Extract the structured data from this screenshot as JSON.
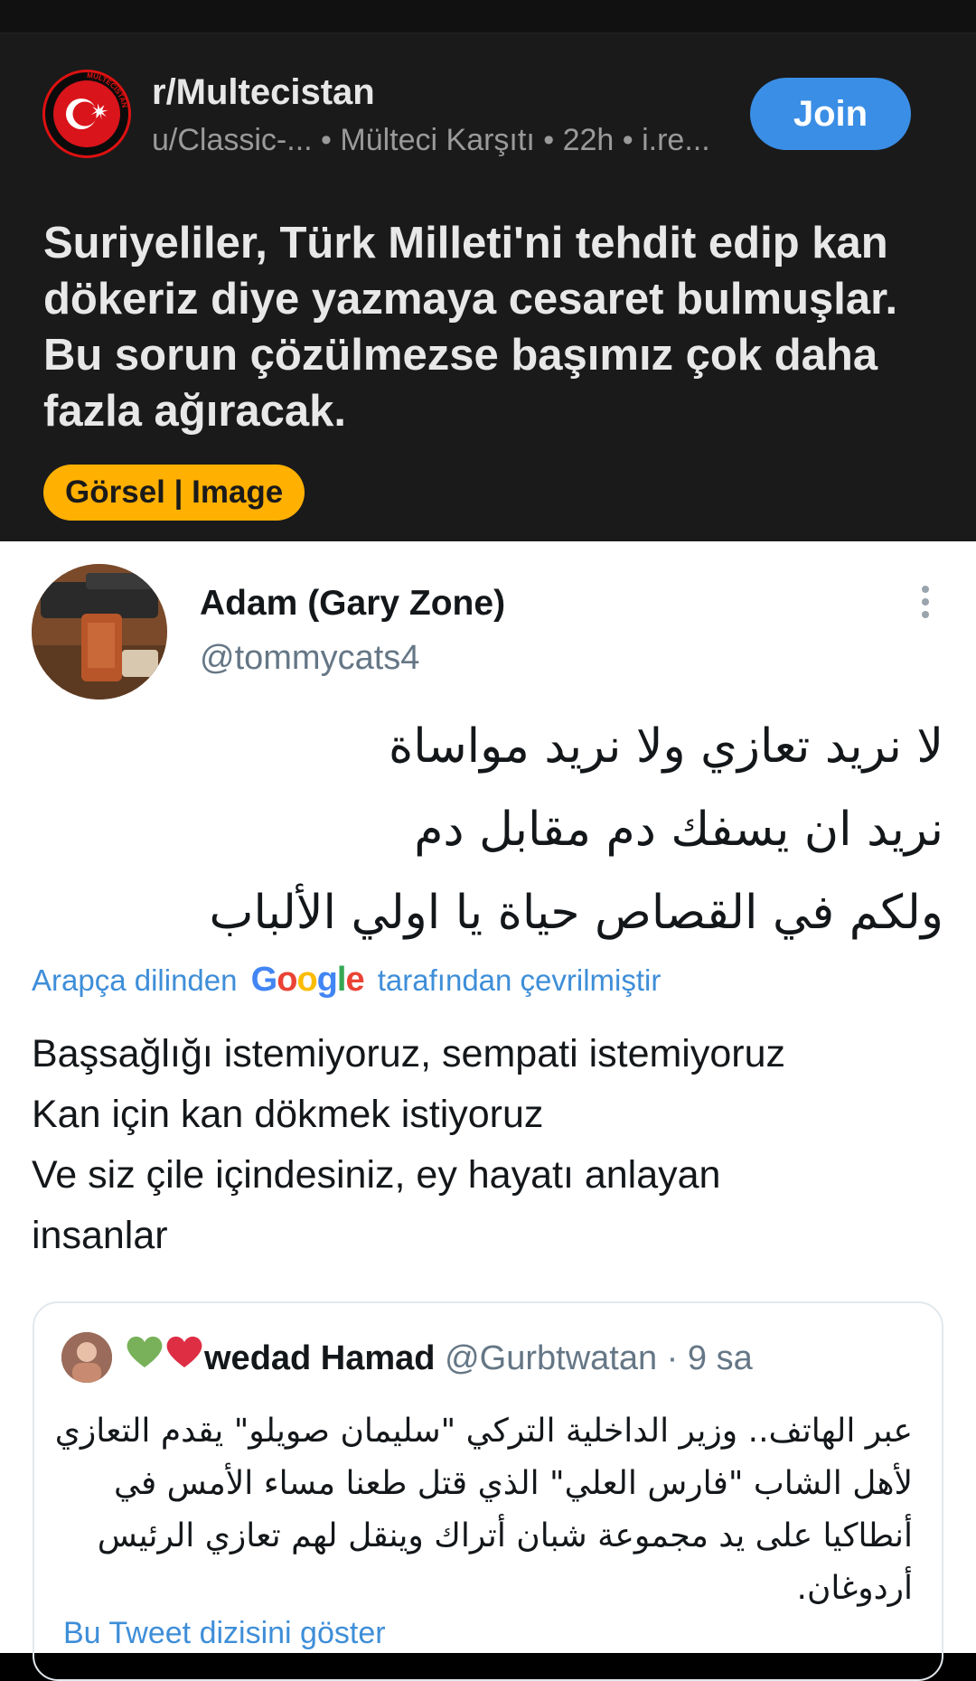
{
  "reddit": {
    "subreddit": "r/Multecistan",
    "meta": "u/Classic-... • Mülteci Karşıtı • 22h • i.re...",
    "join_label": "Join",
    "post_title": "Suriyeliler, Türk Milleti'ni tehdit edip kan dökeriz diye yazmaya cesaret bulmuşlar. Bu sorun çözülmezse başımız çok daha fazla ağıracak.",
    "flair": "Görsel | Image",
    "logo_text": "MULTECISTAN"
  },
  "tweet": {
    "display_name": "Adam (Gary Zone)",
    "handle": "@tommycats4",
    "arabic_lines": [
      "لا نريد تعازي ولا نريد مواساة",
      "نريد ان يسفك دم مقابل دم",
      "ولكم في القصاص حياة يا اولي الألباب"
    ],
    "translate_prefix": "Arapça dilinden",
    "translate_brand": "Google",
    "translate_suffix": "tarafından çevrilmiştir",
    "translation_lines": [
      "Başsağlığı istemiyoruz, sempati istemiyoruz",
      "Kan için kan dökmek istiyoruz",
      "Ve siz çile içindesiniz, ey hayatı anlayan",
      "insanlar"
    ]
  },
  "quote": {
    "name": "wedad Hamad",
    "handle": "@Gurbtwatan",
    "time": "· 9 sa",
    "emojis": "💚❤️",
    "text": "عبر الهاتف.. وزير الداخلية التركي \"سليمان صويلو\" يقدم التعازي لأهل الشاب \"فارس العلي\" الذي قتل طعنا مساء الأمس في أنطاكيا على يد مجموعة شبان أتراك وينقل لهم تعازي الرئيس أردوغان.",
    "show_thread": "Bu Tweet dizisini göster"
  },
  "colors": {
    "reddit_bg": "#1a1a1b",
    "join_blue": "#3a8ee6",
    "flair_yellow": "#ffb000",
    "link_blue": "#3e8ed8",
    "google_blue": "#4285f4",
    "google_red": "#ea4335",
    "google_yellow": "#fbbc05",
    "google_green": "#34a853"
  }
}
